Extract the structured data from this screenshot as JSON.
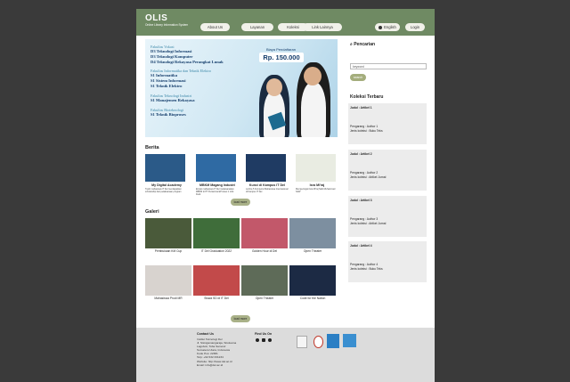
{
  "brand": {
    "title": "OLIS",
    "subtitle": "Online Library Information System"
  },
  "nav": [
    {
      "label": "About Us"
    },
    {
      "label": "Layanan"
    },
    {
      "label": "Koleksi"
    },
    {
      "label": "Link Lainnya"
    }
  ],
  "lang_label": "English",
  "login_label": "Login",
  "banner": {
    "fee_label": "Biaya Pendaftaran",
    "fee_value": "Rp. 150.000",
    "groups": [
      {
        "faculty": "Fakultas Vokasi",
        "programs": [
          "D3 Teknologi Informasi",
          "D3 Teknologi Komputer",
          "D4 Teknologi Rekayasa Perangkat Lunak"
        ]
      },
      {
        "faculty": "Fakultas Informatika dan Teknik Elektro",
        "programs": [
          "S1 Informatika",
          "S1 Sistem Informasi",
          "S1 Teknik Elektro"
        ]
      },
      {
        "faculty": "Fakultas Teknologi Industri",
        "programs": [
          "S1 Manajemen Rekayasa"
        ]
      },
      {
        "faculty": "Fakultas Bioteknologi",
        "programs": [
          "S1 Teknik Bioproses"
        ]
      }
    ]
  },
  "search": {
    "title": "Pencarian",
    "value": "keyword",
    "button": "search"
  },
  "koleksi": {
    "title": "Koleksi Terbaru",
    "items": [
      {
        "judul": "Judul : Artikel 1",
        "pengarang": "Pengarang : Author 1",
        "jenis": "Jenis koleksi : Buku Teks"
      },
      {
        "judul": "Judul : Artikel 2",
        "pengarang": "Pengarang : Author 2",
        "jenis": "Jenis koleksi : Artikel Jurnal"
      },
      {
        "judul": "Judul : Artikel 3",
        "pengarang": "Pengarang : Author 3",
        "jenis": "Jenis koleksi : Artikel Jurnal"
      },
      {
        "judul": "Judul : Artikel 4",
        "pengarang": "Pengarang : Author 4",
        "jenis": "Jenis koleksi : Buku Teks"
      }
    ]
  },
  "berita": {
    "title": "Berita",
    "load_more": "load more",
    "items": [
      {
        "title": "My Digital Academy",
        "text": "Tujuh mahasiswa IT Del mendapatkan scholarship dari pelaksanaan program",
        "color": "#2b5a88"
      },
      {
        "title": "MBKM Magang Industri",
        "text": "Empat mahasiswa IT Del melaksanakan MBKM di PT Pertamina EP Asset 1 Lirik Field",
        "color": "#2f6aa3"
      },
      {
        "title": "Kunci di Kampus IT Del",
        "text": "Lomba 5 Kompetisi Mahasiswa Internasional di Kampus IT Del",
        "color": "#1f3b63"
      },
      {
        "title": "Isra Mi'raj",
        "text": "Memperingati Isra Mi'raj Nabi Muhammad SAW",
        "color": "#e9ece2"
      }
    ]
  },
  "galeri": {
    "title": "Galeri",
    "load_more": "load more",
    "items": [
      {
        "caption": "Pembukaan KM Cup",
        "color": "#4a5a3a"
      },
      {
        "caption": "IT Del Graduation 2022",
        "color": "#3f6d3a"
      },
      {
        "caption": "Golden Hour di Del",
        "color": "#c2586a"
      },
      {
        "caption": "Open Theater",
        "color": "#7d8fa0"
      },
      {
        "caption": "Mahasiswa Prodi MR",
        "color": "#d8d3cf"
      },
      {
        "caption": "Siswa SD di IT Del",
        "color": "#c24a4a"
      },
      {
        "caption": "Open Theater",
        "color": "#5e6b58"
      },
      {
        "caption": "Code for the Nation",
        "color": "#1c2a44"
      }
    ]
  },
  "footer": {
    "contact_title": "Contact Us",
    "contact_lines": [
      "Institut Teknologi Del",
      "Jl. Sisingamangaraja, Sitoluama",
      "Laguboti, Toba Samosir",
      "Sumatera Utara, Indonesia",
      "Kode Pos: 22381",
      "Telp: +62 632 331234",
      "Website: http://www.del.ac.id",
      "Email: info@del.ac.id"
    ],
    "find_title": "Find Us On"
  }
}
